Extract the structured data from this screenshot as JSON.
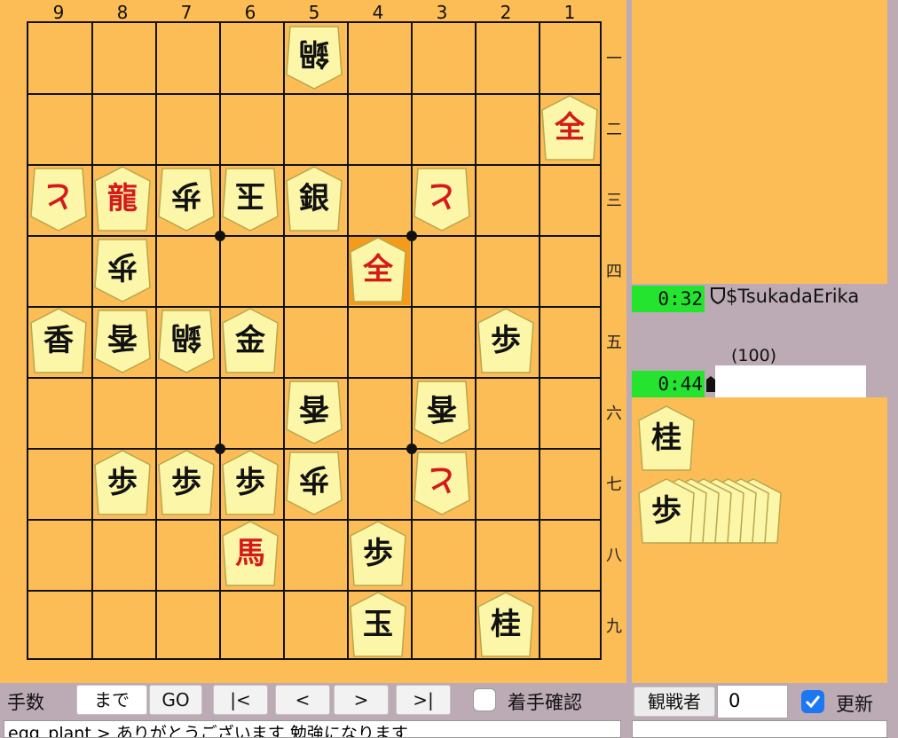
{
  "board": {
    "file_labels": [
      "9",
      "8",
      "7",
      "6",
      "5",
      "4",
      "3",
      "2",
      "1"
    ],
    "rank_labels": [
      "一",
      "二",
      "三",
      "四",
      "五",
      "六",
      "七",
      "八",
      "九"
    ],
    "highlight": {
      "file": 4,
      "rank": 4
    },
    "pieces": [
      {
        "file": 5,
        "rank": 1,
        "char": "鍋",
        "side": "gote",
        "color": "#111"
      },
      {
        "file": 1,
        "rank": 2,
        "char": "全",
        "side": "sente",
        "color": "#d41a1a"
      },
      {
        "file": 9,
        "rank": 3,
        "char": "と",
        "side": "gote",
        "color": "#d41a1a"
      },
      {
        "file": 8,
        "rank": 3,
        "char": "龍",
        "side": "sente",
        "color": "#d41a1a"
      },
      {
        "file": 7,
        "rank": 3,
        "char": "歩",
        "side": "gote",
        "color": "#111"
      },
      {
        "file": 6,
        "rank": 3,
        "char": "玉",
        "side": "gote",
        "color": "#111"
      },
      {
        "file": 5,
        "rank": 3,
        "char": "銀",
        "side": "sente",
        "color": "#111"
      },
      {
        "file": 3,
        "rank": 3,
        "char": "と",
        "side": "gote",
        "color": "#d41a1a"
      },
      {
        "file": 8,
        "rank": 4,
        "char": "歩",
        "side": "gote",
        "color": "#111"
      },
      {
        "file": 4,
        "rank": 4,
        "char": "全",
        "side": "sente",
        "color": "#d41a1a"
      },
      {
        "file": 9,
        "rank": 5,
        "char": "香",
        "side": "sente",
        "color": "#111"
      },
      {
        "file": 8,
        "rank": 5,
        "char": "香",
        "side": "gote",
        "color": "#111"
      },
      {
        "file": 7,
        "rank": 5,
        "char": "鍋",
        "side": "gote",
        "color": "#111"
      },
      {
        "file": 6,
        "rank": 5,
        "char": "金",
        "side": "sente",
        "color": "#111"
      },
      {
        "file": 2,
        "rank": 5,
        "char": "歩",
        "side": "sente",
        "color": "#111"
      },
      {
        "file": 5,
        "rank": 6,
        "char": "香",
        "side": "gote",
        "color": "#111"
      },
      {
        "file": 3,
        "rank": 6,
        "char": "香",
        "side": "gote",
        "color": "#111"
      },
      {
        "file": 8,
        "rank": 7,
        "char": "歩",
        "side": "sente",
        "color": "#111"
      },
      {
        "file": 7,
        "rank": 7,
        "char": "歩",
        "side": "sente",
        "color": "#111"
      },
      {
        "file": 6,
        "rank": 7,
        "char": "歩",
        "side": "sente",
        "color": "#111"
      },
      {
        "file": 5,
        "rank": 7,
        "char": "歩",
        "side": "gote",
        "color": "#111"
      },
      {
        "file": 3,
        "rank": 7,
        "char": "と",
        "side": "gote",
        "color": "#d41a1a"
      },
      {
        "file": 6,
        "rank": 8,
        "char": "馬",
        "side": "sente",
        "color": "#d41a1a"
      },
      {
        "file": 4,
        "rank": 8,
        "char": "歩",
        "side": "sente",
        "color": "#111"
      },
      {
        "file": 4,
        "rank": 9,
        "char": "玉",
        "side": "sente",
        "color": "#111"
      },
      {
        "file": 2,
        "rank": 9,
        "char": "桂",
        "side": "sente",
        "color": "#111"
      }
    ]
  },
  "players": {
    "top": {
      "clock": "0:32",
      "name": "$TsukadaErika"
    },
    "bottom": {
      "clock": "0:44",
      "rating": "(100)"
    }
  },
  "hand": {
    "bottom": [
      {
        "char": "桂",
        "count": 1
      },
      {
        "char": "歩",
        "count": 8
      }
    ]
  },
  "controls": {
    "moves_label": "手数",
    "until_label": "まで",
    "go_label": "GO",
    "first_label": "|<",
    "prev_label": "<",
    "next_label": ">",
    "last_label": ">|",
    "confirm_label": "着手確認",
    "confirm_checked": false,
    "spectators_label": "観戦者",
    "spectators_value": "0",
    "refresh_label": "更新",
    "refresh_checked": true
  },
  "chat": {
    "line": "egg_plant > ありがとうございます 勉強になります"
  },
  "colors": {
    "board": "#fdbd56",
    "highlight": "#f59b1b",
    "clock": "#24e42f",
    "piece_face": "#fbf6a8",
    "checkbox_on": "#1b77f2"
  }
}
